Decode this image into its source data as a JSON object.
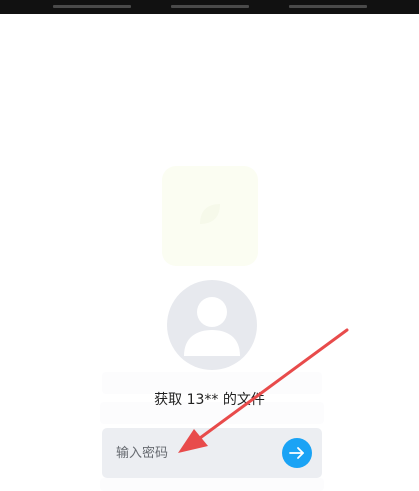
{
  "file_caption": "获取 13** 的文件",
  "password": {
    "placeholder": "输入密码",
    "value": ""
  },
  "icons": {
    "avatar": "user-avatar-icon",
    "submit": "arrow-right-icon",
    "annotation": "red-pointer-arrow"
  },
  "colors": {
    "submit_button": "#1aa3f5",
    "annotation_arrow": "#e84b4b",
    "avatar_bg": "#e7e9ee",
    "input_bg": "#eceef2"
  }
}
